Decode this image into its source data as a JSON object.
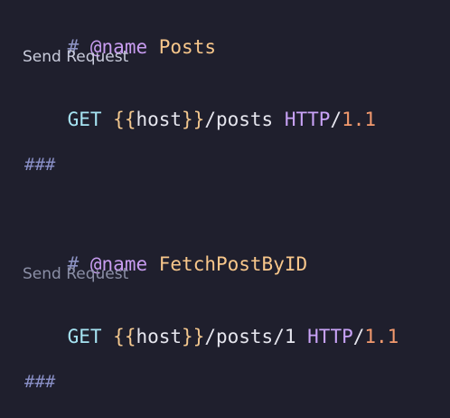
{
  "colors": {
    "background": "#1f1f2d",
    "comment": "#8d93c4",
    "annotation": "#c89cf0",
    "request_name": "#f8c78b",
    "method": "#a6e3f2",
    "template_braces": "#f3c78e",
    "protocol": "#c9a3f7",
    "version": "#f39a6e",
    "codelens": "#c9ccdc",
    "codelens_dim": "#8b8fa6"
  },
  "requests": [
    {
      "comment_hash": "#",
      "annotation": "@name",
      "name": "Posts",
      "codelens": "Send Request",
      "method": "GET",
      "brace_open": "{{",
      "variable": "host",
      "brace_close": "}}",
      "path": "/posts",
      "protocol": "HTTP",
      "protocol_slash": "/",
      "version": "1.1",
      "separator": "###"
    },
    {
      "comment_hash": "#",
      "annotation": "@name",
      "name": "FetchPostByID",
      "codelens": "Send Request",
      "method": "GET",
      "brace_open": "{{",
      "variable": "host",
      "brace_close": "}}",
      "path": "/posts/1",
      "protocol": "HTTP",
      "protocol_slash": "/",
      "version": "1.1",
      "separator": "###"
    }
  ]
}
